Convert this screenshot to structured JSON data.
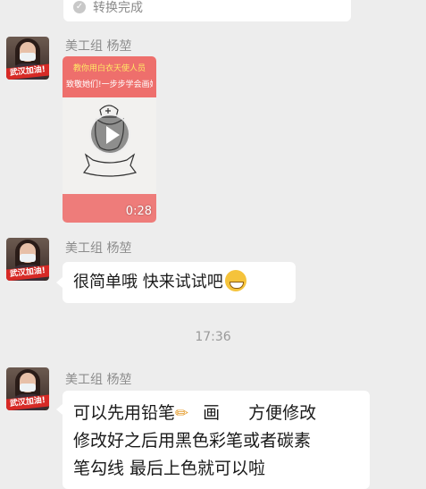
{
  "convert_notice": {
    "text": "转换完成",
    "icon": "check-circle-icon"
  },
  "messages": [
    {
      "sender": "美工组 杨堃",
      "avatar_banner": "武汉加油!",
      "type": "video",
      "video": {
        "caption_line1": "教你用白衣天使人员",
        "caption_line2": "致敬她们!一步步学会画她",
        "duration": "0:28"
      }
    },
    {
      "sender": "美工组 杨堃",
      "avatar_banner": "武汉加油!",
      "type": "text",
      "text": "很简单哦   快来试试吧"
    },
    {
      "sender": "美工组 杨堃",
      "avatar_banner": "武汉加油!",
      "type": "text",
      "lines": [
        "可以先用铅笔",
        "画",
        "方便修改",
        "修改好之后用黑色彩笔或者碳素",
        "笔勾线   最后上色就可以啦"
      ]
    }
  ],
  "time_divider": "17:36",
  "colors": {
    "background": "#ededed",
    "bubble": "#ffffff",
    "video_accent": "#ee6f6c",
    "avatar_banner": "#d72a26"
  }
}
